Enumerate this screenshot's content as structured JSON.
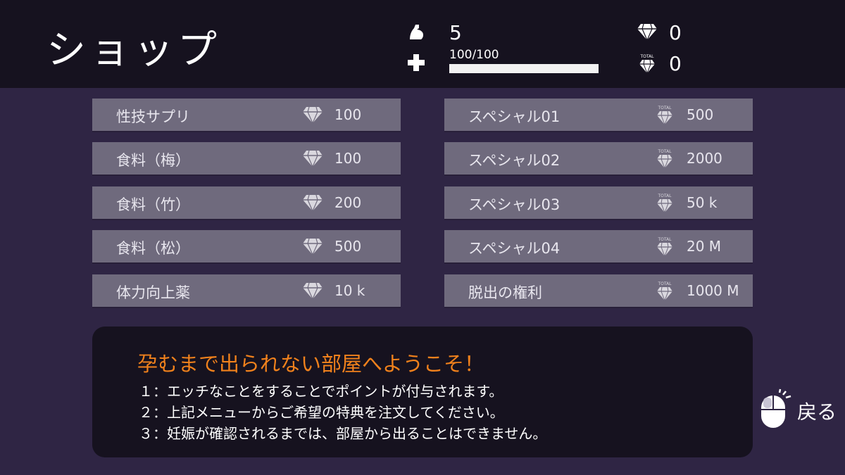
{
  "header": {
    "title": "ショップ",
    "strength_value": "5",
    "hp_text": "100/100",
    "hp_fraction": 1.0,
    "gems_value": "0",
    "total_label": "TOTAL",
    "total_gems_value": "0"
  },
  "shop": {
    "left_items": [
      {
        "name": "性技サプリ",
        "price": "100",
        "currency": "gem"
      },
      {
        "name": "食料（梅）",
        "price": "100",
        "currency": "gem"
      },
      {
        "name": "食料（竹）",
        "price": "200",
        "currency": "gem"
      },
      {
        "name": "食料（松）",
        "price": "500",
        "currency": "gem"
      },
      {
        "name": "体力向上薬",
        "price": "10 k",
        "currency": "gem"
      }
    ],
    "right_items": [
      {
        "name": "スペシャル01",
        "price": "500",
        "currency": "total-gem"
      },
      {
        "name": "スペシャル02",
        "price": "2000",
        "currency": "total-gem"
      },
      {
        "name": "スペシャル03",
        "price": "50 k",
        "currency": "total-gem"
      },
      {
        "name": "スペシャル04",
        "price": "20 M",
        "currency": "total-gem"
      },
      {
        "name": "脱出の権利",
        "price": "1000 M",
        "currency": "total-gem"
      }
    ]
  },
  "message": {
    "heading": "孕むまで出られない部屋へようこそ！",
    "lines": [
      "１：エッチなことをすることでポイントが付与されます。",
      "２：上記メニューからご希望の特典を注文してください。",
      "３：妊娠が確認されるまでは、部屋から出ることはできません。"
    ]
  },
  "back": {
    "label": "戻る"
  },
  "colors": {
    "background": "#2f2544",
    "header": "#16121f",
    "item": "#6f6a7d",
    "accent": "#f0811c"
  }
}
